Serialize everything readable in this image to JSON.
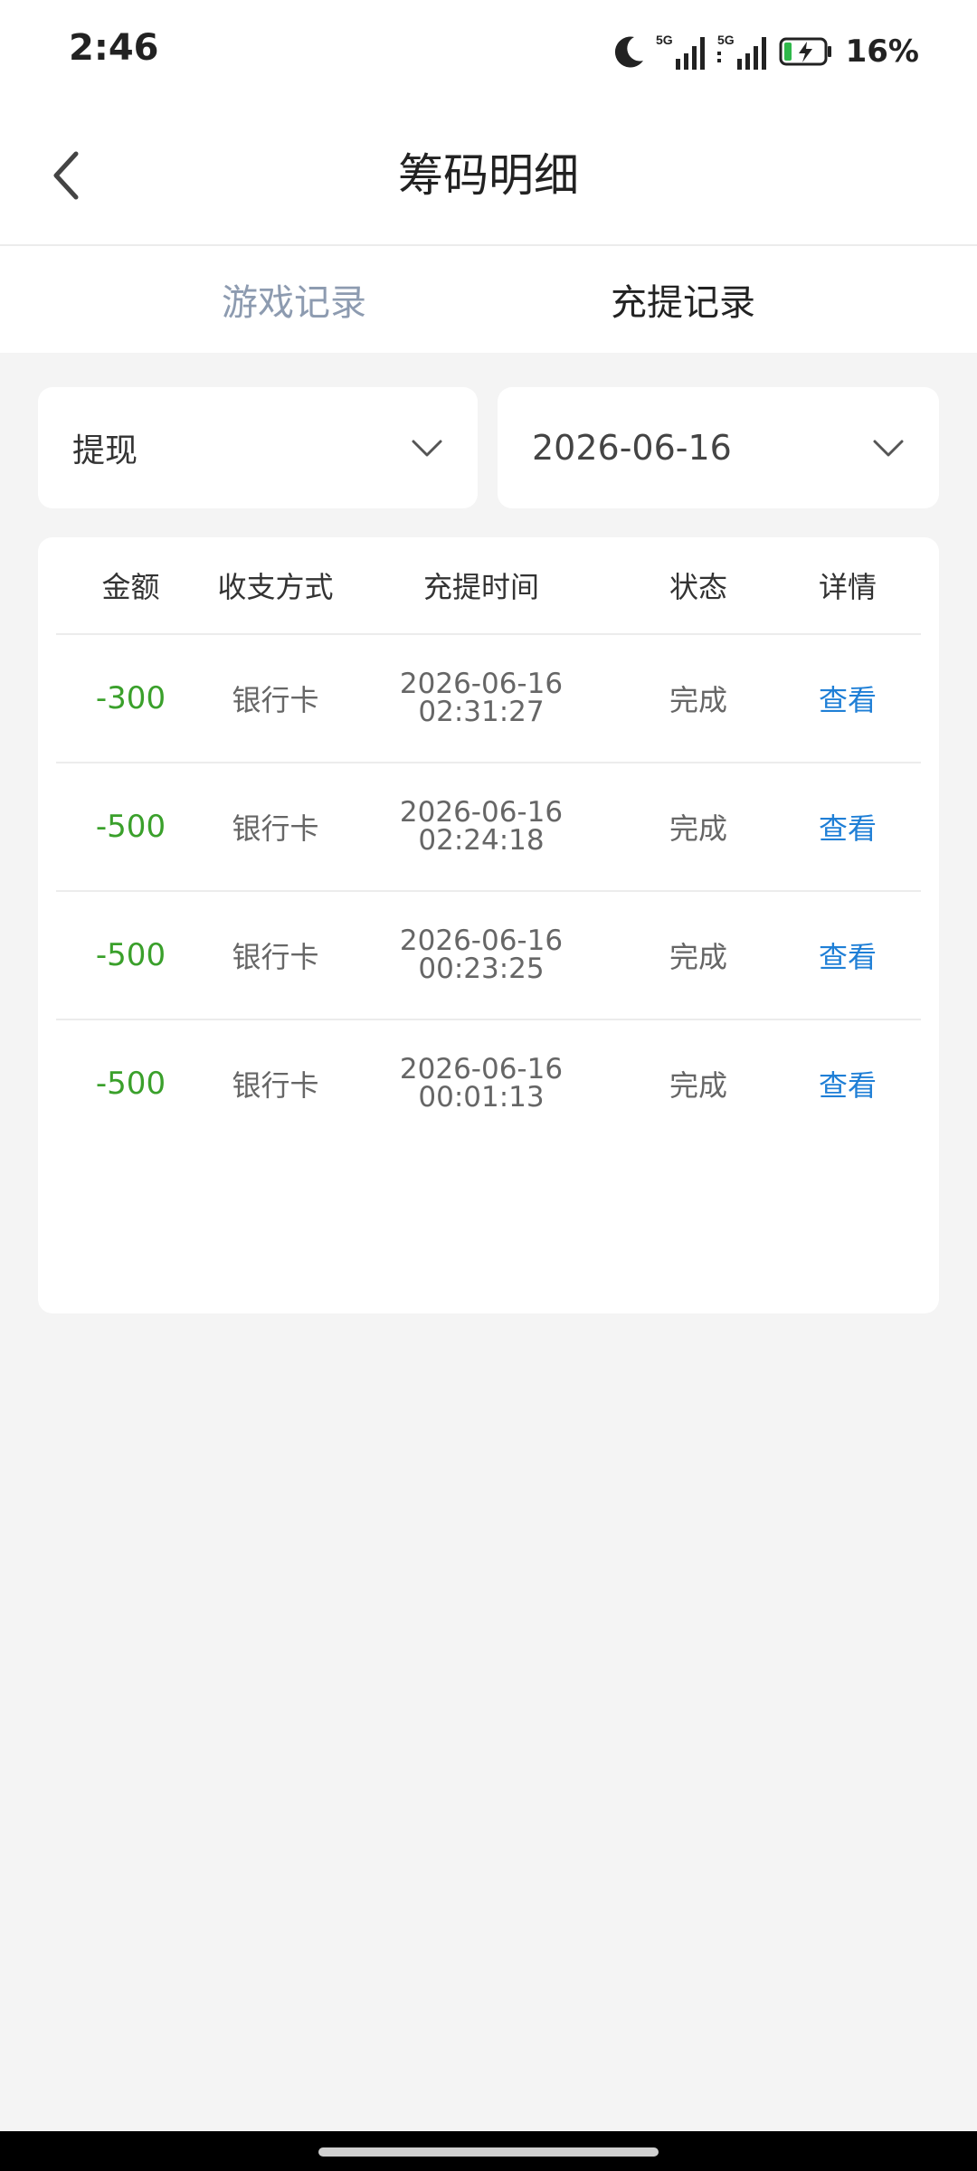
{
  "status_bar": {
    "time": "2:46",
    "network_1": "5G",
    "network_2": "5G",
    "battery": "16%"
  },
  "header": {
    "title": "筹码明细"
  },
  "tabs": [
    {
      "label": "游戏记录",
      "active": false
    },
    {
      "label": "充提记录",
      "active": true
    }
  ],
  "filters": {
    "type": "提现",
    "date": "2026-06-16"
  },
  "table": {
    "columns": [
      "金额",
      "收支方式",
      "充提时间",
      "状态",
      "详情"
    ],
    "rows": [
      {
        "amount": "-300",
        "method": "银行卡",
        "date": "2026-06-16",
        "time": "02:31:27",
        "status": "完成",
        "detail": "查看"
      },
      {
        "amount": "-500",
        "method": "银行卡",
        "date": "2026-06-16",
        "time": "02:24:18",
        "status": "完成",
        "detail": "查看"
      },
      {
        "amount": "-500",
        "method": "银行卡",
        "date": "2026-06-16",
        "time": "00:23:25",
        "status": "完成",
        "detail": "查看"
      },
      {
        "amount": "-500",
        "method": "银行卡",
        "date": "2026-06-16",
        "time": "00:01:13",
        "status": "完成",
        "detail": "查看"
      }
    ]
  },
  "colors": {
    "amount_negative": "#3aa02b",
    "link": "#1f7fd6",
    "tab_inactive": "#8d9bb0",
    "battery_charge": "#2fb84a"
  }
}
